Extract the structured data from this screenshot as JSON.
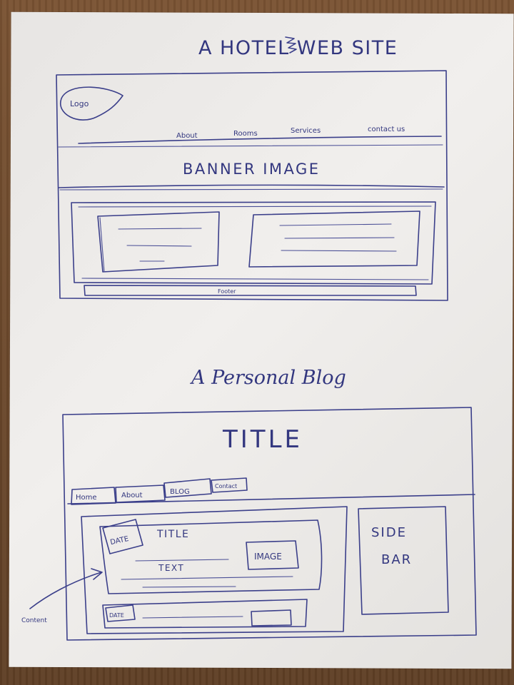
{
  "hotel": {
    "heading": "A HOTEL WEB SITE",
    "logo": "Logo",
    "nav": [
      "About",
      "Rooms",
      "Services",
      "contact us"
    ],
    "banner": "BANNER IMAGE",
    "footer": "Footer"
  },
  "blog": {
    "heading": "A Personal Blog",
    "title": "TITLE",
    "tabs": [
      "Home",
      "About",
      "BLOG",
      "Contact"
    ],
    "post_date": "DATE",
    "post_title": "TITLE",
    "post_image": "IMAGE",
    "post_text": "TEXT",
    "second_date": "DATE",
    "sidebar": [
      "SIDE",
      "BAR"
    ],
    "content_note": "Content"
  },
  "colors": {
    "ink": "#3b3f8a",
    "paper": "#ecebe9",
    "table": "#6e4a2c"
  }
}
